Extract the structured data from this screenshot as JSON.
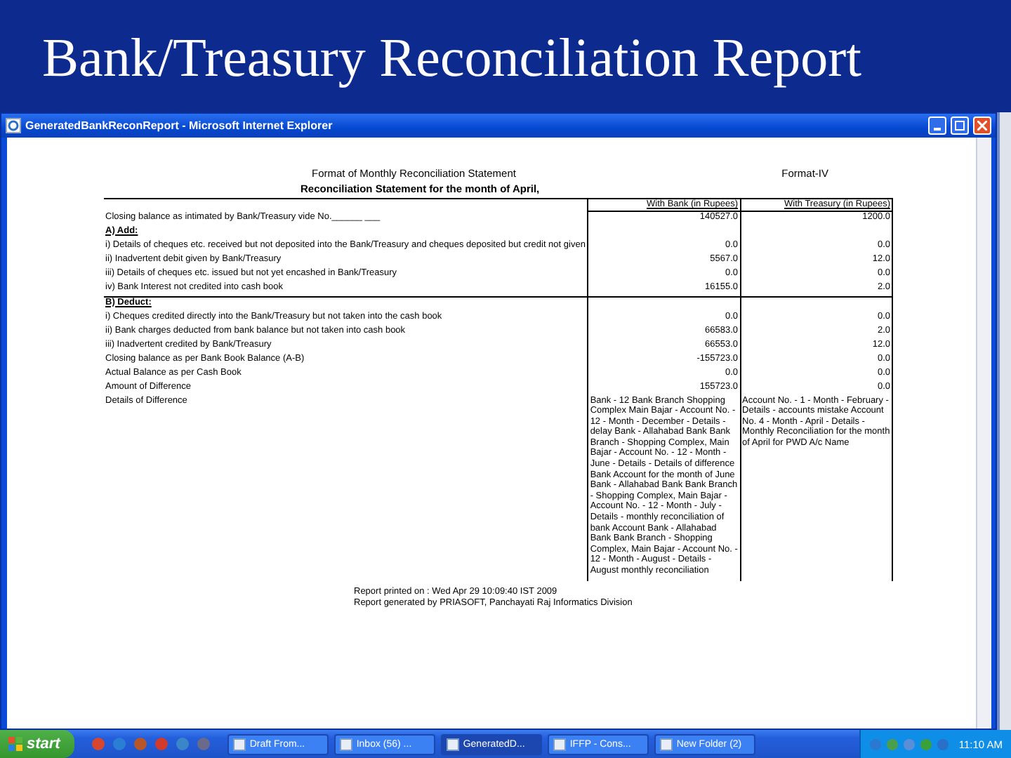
{
  "slide_title": "Bank/Treasury Reconciliation Report",
  "window": {
    "title": "GeneratedBankReconReport - Microsoft Internet Explorer"
  },
  "report": {
    "heading": "Format of Monthly Reconciliation Statement",
    "format": "Format-IV",
    "subheading": "Reconciliation Statement for the month of April,",
    "columns": [
      "With Bank (in Rupees)",
      "With Treasury (in Rupees)"
    ],
    "groups": [
      {
        "rows": [
          {
            "kind": "item",
            "label": "Closing balance as intimated by Bank/Treasury vide No.______ ___",
            "bank": "140527.0",
            "treasury": "1200.0"
          },
          {
            "kind": "section",
            "label": "A) Add:"
          },
          {
            "kind": "item",
            "label": "i) Details of cheques etc. received but not deposited into the Bank/Treasury and cheques deposited but credit not given",
            "bank": "0.0",
            "treasury": "0.0"
          },
          {
            "kind": "item",
            "label": "ii) Inadvertent debit given by Bank/Treasury",
            "bank": "5567.0",
            "treasury": "12.0"
          },
          {
            "kind": "item",
            "label": "iii) Details of cheques etc. issued but not yet encashed in Bank/Treasury",
            "bank": "0.0",
            "treasury": "0.0"
          },
          {
            "kind": "item",
            "label": "iv) Bank Interest not credited into cash book",
            "bank": "16155.0",
            "treasury": "2.0"
          }
        ]
      },
      {
        "rows": [
          {
            "kind": "section",
            "label": "B) Deduct:"
          },
          {
            "kind": "item",
            "label": "i) Cheques credited directly into the Bank/Treasury but not taken into the cash book",
            "bank": "0.0",
            "treasury": "0.0"
          },
          {
            "kind": "item",
            "label": "ii) Bank charges deducted from bank balance but not taken into cash book",
            "bank": "66583.0",
            "treasury": "2.0"
          },
          {
            "kind": "item",
            "label": "iii) Inadvertent credited by Bank/Treasury",
            "bank": "66553.0",
            "treasury": "12.0"
          },
          {
            "kind": "item",
            "label": "Closing balance as per Bank Book Balance (A-B)",
            "bank": "-155723.0",
            "treasury": "0.0"
          },
          {
            "kind": "item",
            "label": "Actual Balance as per Cash Book",
            "bank": "0.0",
            "treasury": "0.0"
          },
          {
            "kind": "item",
            "label": "Amount of Difference",
            "bank": "155723.0",
            "treasury": "0.0"
          },
          {
            "kind": "details",
            "label": "Details of Difference",
            "bank": "Bank - 12 Bank Branch Shopping Complex Main Bajar - Account No. - 12 - Month - December - Details - delay Bank - Allahabad Bank Bank Branch - Shopping Complex, Main Bajar - Account No. - 12 - Month - June - Details - Details of difference Bank Account for the month of June Bank - Allahabad Bank Bank Branch - Shopping Complex, Main Bajar - Account No. - 12 - Month - July - Details - monthly reconciliation of bank Account Bank - Allahabad Bank Bank Branch - Shopping Complex, Main Bajar - Account No. - 12 - Month - August - Details - August monthly reconciliation",
            "treasury": "Account No. - 1 - Month - February - Details - accounts mistake Account No. 4 - Month - April - Details - Monthly Reconciliation for the month of April for PWD A/c Name"
          }
        ]
      }
    ],
    "printed": "Report printed on : Wed Apr 29 10:09:40 IST 2009",
    "generated": "Report generated by PRIASOFT, Panchayati Raj Informatics Division"
  },
  "taskbar": {
    "start": "start",
    "tasks": [
      {
        "label": "Draft From...",
        "selected": false
      },
      {
        "label": "Inbox (56) ...",
        "selected": false
      },
      {
        "label": "GeneratedD...",
        "selected": true
      },
      {
        "label": "IFFP - Cons...",
        "selected": false
      },
      {
        "label": "New Folder (2)",
        "selected": false
      }
    ],
    "clock": "11:10 AM"
  }
}
